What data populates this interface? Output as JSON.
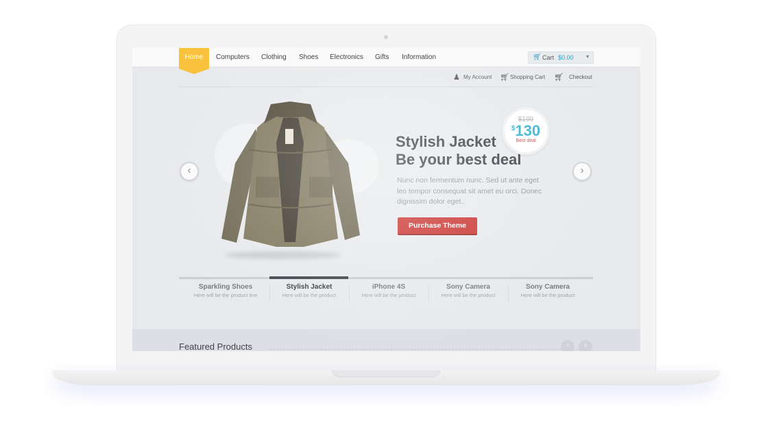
{
  "nav": {
    "items": [
      "Home",
      "Computers",
      "Clothing",
      "Shoes",
      "Electronics",
      "Gifts",
      "Information"
    ],
    "cart_label": "Cart",
    "cart_amount": "$0.00"
  },
  "subnav": {
    "my_account": "My Account",
    "shopping_cart": "Shopping Cart",
    "checkout": "Checkout"
  },
  "hero": {
    "title_line1": "Stylish Jacket",
    "title_line2": "Be your best deal",
    "text": "Nunc non fermentum nunc. Sed ut ante eget leo tempor consequat sit amet eu orci. Donec dignissim dolor eget..",
    "button_label": "Purchase Theme",
    "old_price": "$199",
    "currency": "$",
    "new_price": "130",
    "deal_label": "Best deal"
  },
  "slides": [
    {
      "title": "Sparkling Shoes",
      "subtitle": "Here will be the product line"
    },
    {
      "title": "Stylish Jacket",
      "subtitle": "Here will be the product"
    },
    {
      "title": "iPhone 4S",
      "subtitle": "Here will be the product"
    },
    {
      "title": "Sony Camera",
      "subtitle": "Here will be the product"
    },
    {
      "title": "Sony Camera",
      "subtitle": "Here will be the product"
    }
  ],
  "active_slide": 1,
  "featured": {
    "title": "Featured Products"
  },
  "colors": {
    "accent_yellow": "#f9c23c",
    "button_red": "#c9302c",
    "price_blue": "#30b1cc",
    "deal_red": "#d9363e"
  },
  "icons": {
    "cart": "shopping-cart-icon",
    "account": "user-icon",
    "checkout": "cart-arrow-icon",
    "prev": "chevron-left-icon",
    "next": "chevron-right-icon"
  }
}
